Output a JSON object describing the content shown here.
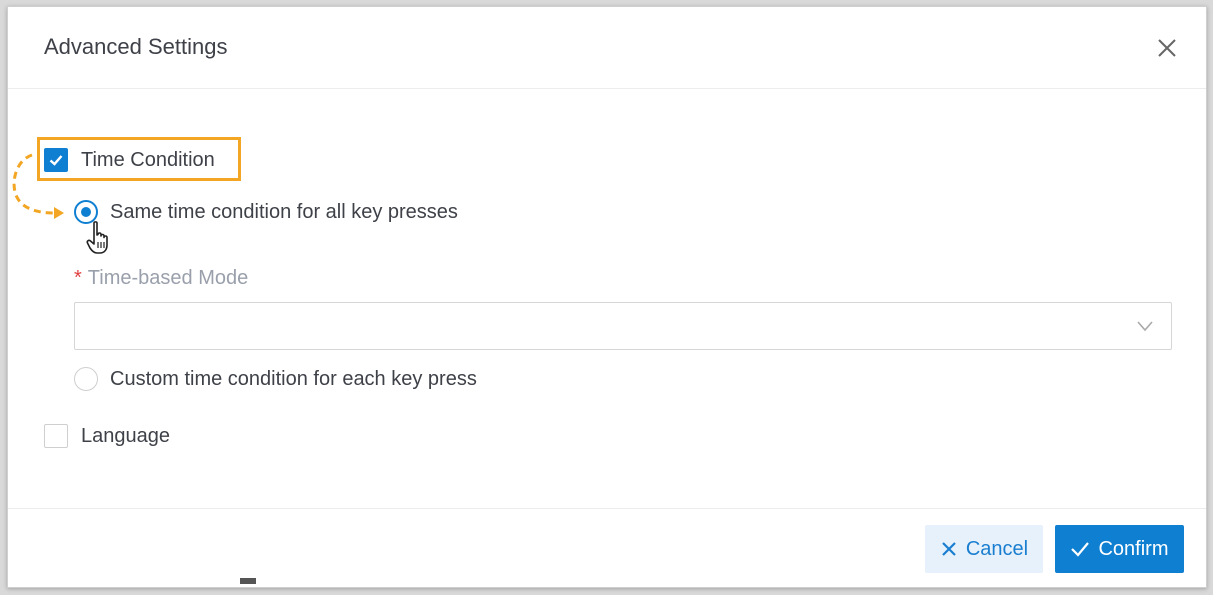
{
  "dialog": {
    "title": "Advanced Settings",
    "close_icon": "close-icon"
  },
  "options": {
    "time_condition": {
      "label": "Time Condition",
      "checked": true
    },
    "same_time": {
      "label": "Same time condition for all key presses",
      "selected": true
    },
    "time_based_mode": {
      "required_mark": "*",
      "label": "Time-based Mode",
      "value": ""
    },
    "custom_time": {
      "label": "Custom time condition for each key press",
      "selected": false
    },
    "language": {
      "label": "Language",
      "checked": false
    }
  },
  "footer": {
    "cancel_label": "Cancel",
    "confirm_label": "Confirm"
  },
  "colors": {
    "accent": "#0f7fd2",
    "highlight": "#f2a624",
    "required": "#e04040"
  }
}
